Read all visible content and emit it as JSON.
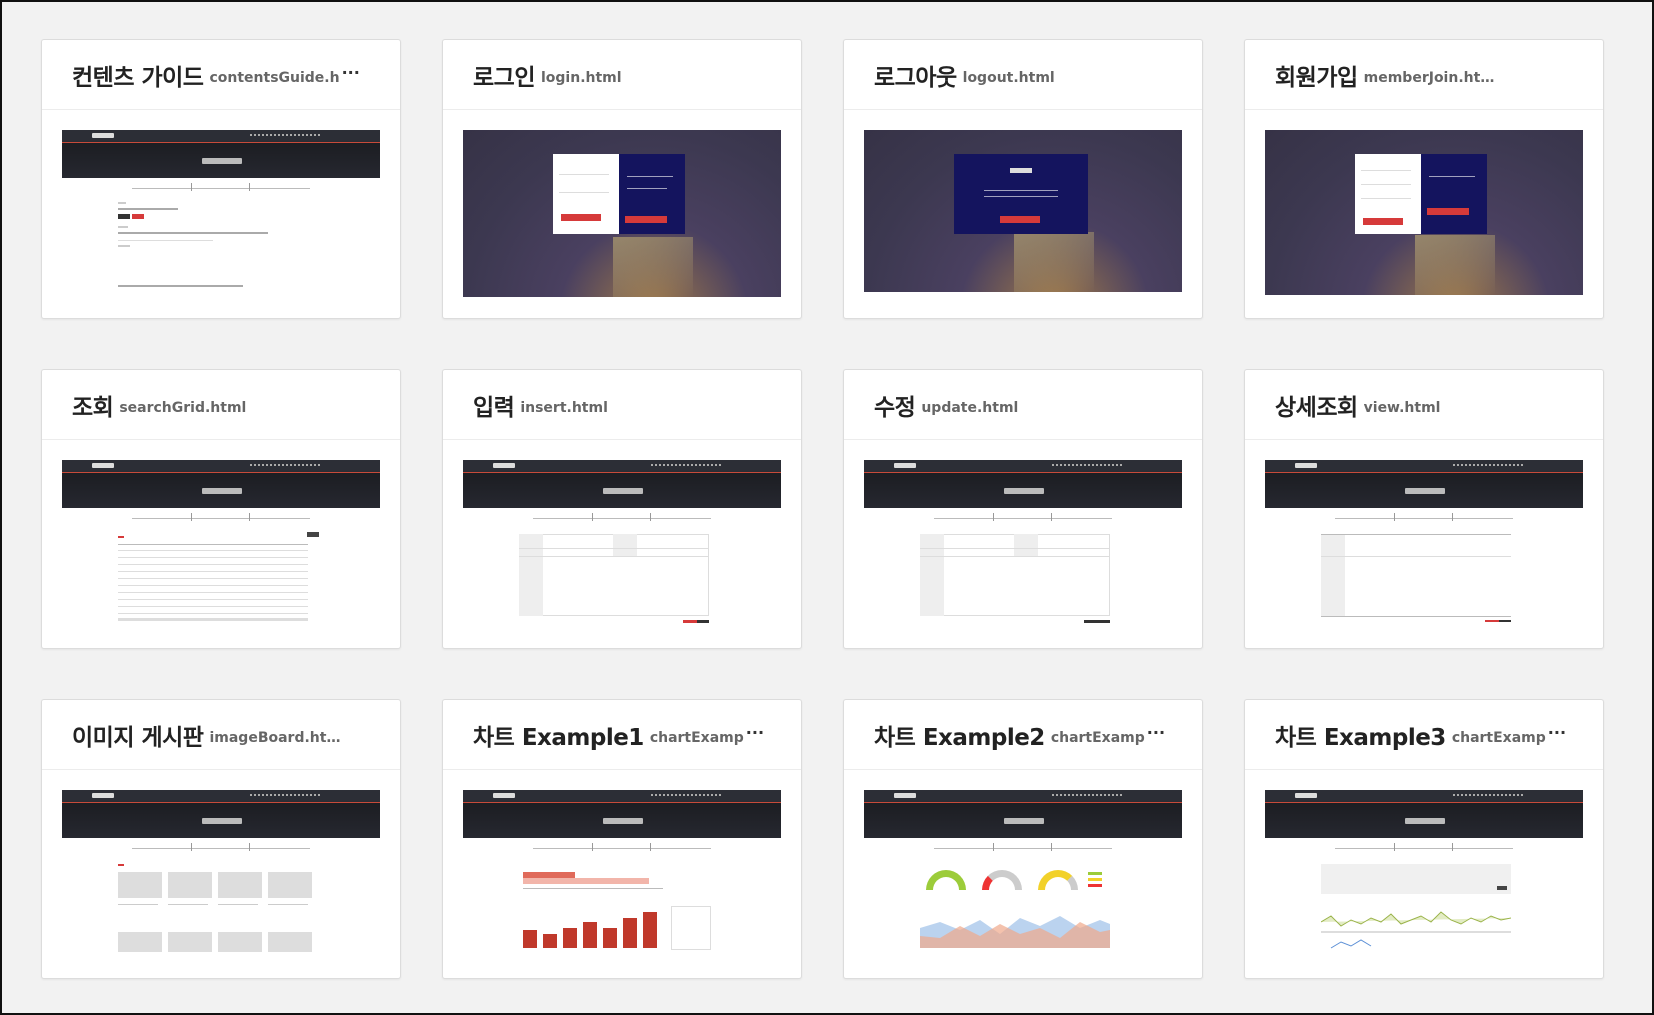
{
  "cards": [
    {
      "title": "컨텐츠 가이드",
      "file": "contentsGuide.h",
      "ellipsis": "···",
      "thumb": "content"
    },
    {
      "title": "로그인",
      "file": "login.html",
      "ellipsis": "",
      "thumb": "login"
    },
    {
      "title": "로그아웃",
      "file": "logout.html",
      "ellipsis": "",
      "thumb": "logout"
    },
    {
      "title": "회원가입",
      "file": "memberJoin.html",
      "ellipsis": "",
      "thumb": "join"
    },
    {
      "title": "조회",
      "file": "searchGrid.html",
      "ellipsis": "",
      "thumb": "grid"
    },
    {
      "title": "입력",
      "file": "insert.html",
      "ellipsis": "",
      "thumb": "form"
    },
    {
      "title": "수정",
      "file": "update.html",
      "ellipsis": "",
      "thumb": "form"
    },
    {
      "title": "상세조회",
      "file": "view.html",
      "ellipsis": "",
      "thumb": "view"
    },
    {
      "title": "이미지 게시판",
      "file": "imageBoard.html",
      "ellipsis": "",
      "thumb": "image"
    },
    {
      "title": "차트 Example1",
      "file": "chartExamp",
      "ellipsis": "···",
      "thumb": "chart1"
    },
    {
      "title": "차트 Example2",
      "file": "chartExamp",
      "ellipsis": "···",
      "thumb": "chart2"
    },
    {
      "title": "차트 Example3",
      "file": "chartExamp",
      "ellipsis": "···",
      "thumb": "chart3"
    }
  ]
}
